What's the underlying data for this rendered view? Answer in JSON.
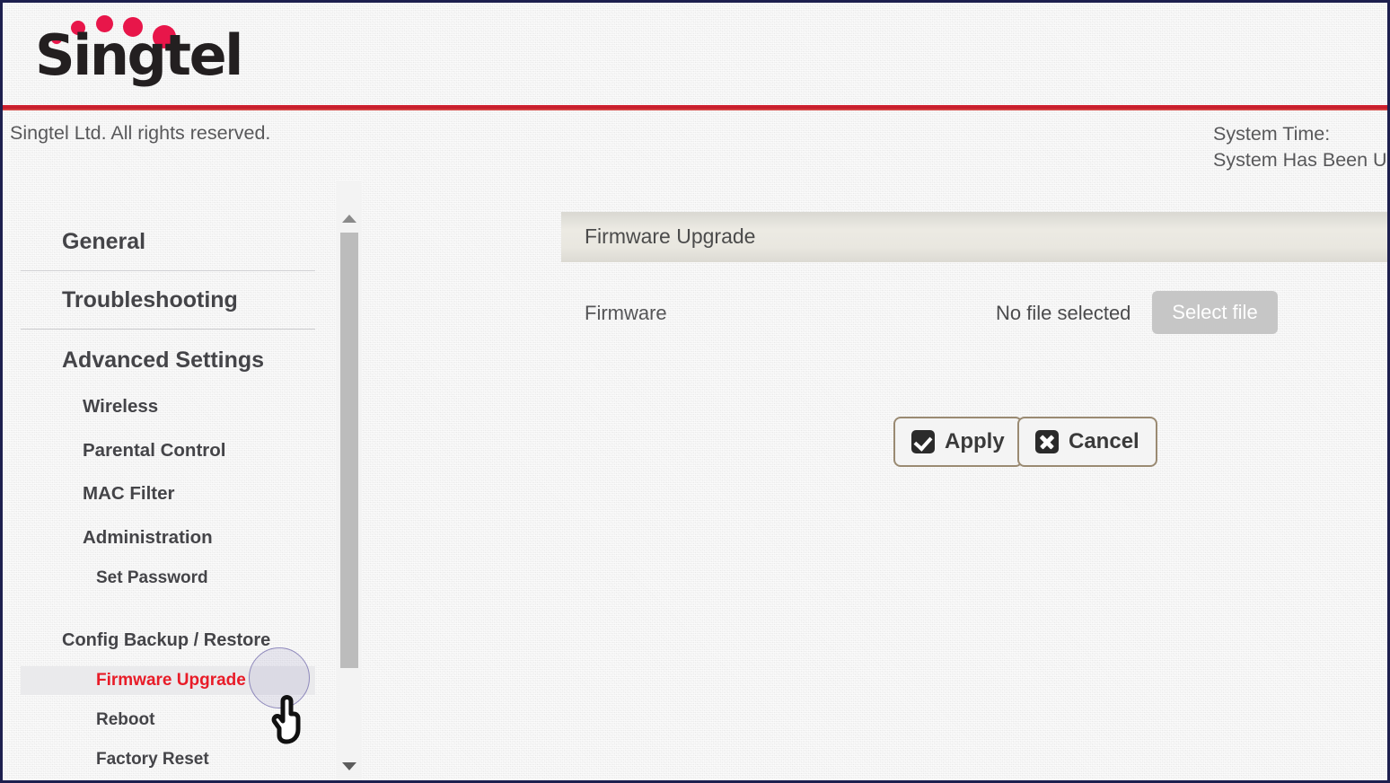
{
  "brand": {
    "name": "Singtel",
    "logo_dot_color": "#e8164a",
    "wordmark_color": "#231f20",
    "accent_rule_color": "#c31b2a"
  },
  "header": {
    "copyright": "Singtel Ltd. All rights reserved.",
    "system_time_label": "System Time:",
    "system_uptime_label": "System Has Been U"
  },
  "sidebar": {
    "items": [
      {
        "label": "General",
        "level": 1,
        "active": false
      },
      {
        "label": "Troubleshooting",
        "level": 1,
        "active": false
      },
      {
        "label": "Advanced Settings",
        "level": 1,
        "active": false
      },
      {
        "label": "Wireless",
        "level": 2,
        "active": false
      },
      {
        "label": "Parental Control",
        "level": 2,
        "active": false
      },
      {
        "label": "MAC Filter",
        "level": 2,
        "active": false
      },
      {
        "label": "Administration",
        "level": 2,
        "active": false
      },
      {
        "label": "Set Password",
        "level": 3,
        "active": false
      },
      {
        "label": "Config Backup / Restore",
        "level": 0,
        "active": false
      },
      {
        "label": "Firmware Upgrade",
        "level": 3,
        "active": true
      },
      {
        "label": "Reboot",
        "level": 3,
        "active": false
      },
      {
        "label": "Factory Reset",
        "level": 3,
        "active": false
      }
    ],
    "active_item_color": "#e81c28",
    "active_row_background": "#eaeaec"
  },
  "main": {
    "panel_title": "Firmware Upgrade",
    "field_label": "Firmware",
    "file_status": "No file selected",
    "select_file_label": "Select file",
    "apply_label": "Apply",
    "cancel_label": "Cancel"
  },
  "icons": {
    "apply": "check-icon",
    "cancel": "cross-icon",
    "scroll_up": "triangle-up-icon",
    "scroll_down": "triangle-down-icon",
    "pointer": "hand-pointer-cursor"
  }
}
